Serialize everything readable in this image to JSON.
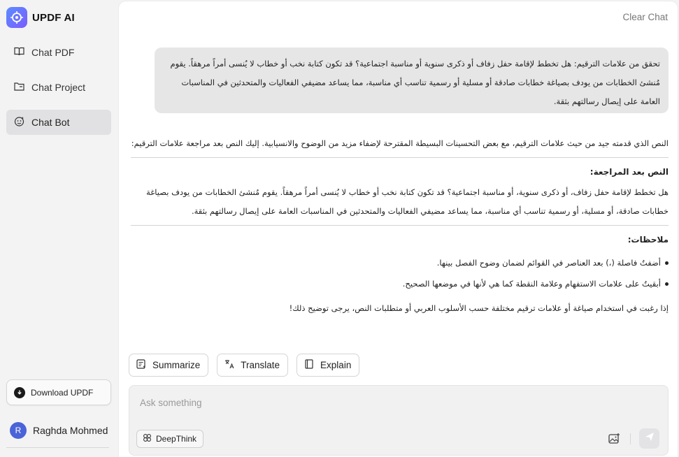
{
  "brand": {
    "name": "UPDF AI"
  },
  "sidebar": {
    "items": [
      {
        "label": "Chat PDF",
        "icon": "book-open-icon"
      },
      {
        "label": "Chat Project",
        "icon": "folder-icon"
      },
      {
        "label": "Chat Bot",
        "icon": "bot-face-icon",
        "active": true
      }
    ],
    "download_label": "Download UPDF",
    "user_initial": "R",
    "user_name": "Raghda Mohmed"
  },
  "header": {
    "clear_chat": "Clear Chat"
  },
  "conversation": {
    "user_message": "تحقق من علامات الترقيم: هل تخطط لإقامة حفل زفاف أو ذكرى سنوية أو مناسبة اجتماعية؟ قد تكون كتابة نخب أو خطاب لا يُنسى أمراً مرهقاً. يقوم مُنشئ الخطابات من يودف بصياغة خطابات صادقة أو مسلية أو رسمية تناسب أي مناسبة، مما يساعد مضيفي الفعاليات والمتحدثين في المناسبات العامة على إيصال رسالتهم بثقة.",
    "answer": {
      "intro": "النص الذي قدمته جيد من حيث علامات الترقيم، مع بعض التحسينات البسيطة المقترحة لإضفاء مزيد من الوضوح والانسيابية. إليك النص بعد مراجعة علامات الترقيم:",
      "revised_heading": "النص بعد المراجعة:",
      "revised_text": "هل تخطط لإقامة حفل زفاف، أو ذكرى سنوية، أو مناسبة اجتماعية؟ قد تكون كتابة نخب أو خطاب لا يُنسى أمراً مرهقاً. يقوم مُنشئ الخطابات من يودف بصياغة خطابات صادقة، أو مسلية، أو رسمية تناسب أي مناسبة، مما يساعد مضيفي الفعاليات والمتحدثين في المناسبات العامة على إيصال رسالتهم بثقة.",
      "notes_heading": "ملاحظات:",
      "notes": [
        "أضفتُ فاصلة (،) بعد العناصر في القوائم لضمان وضوح الفصل بينها.",
        "أبقيتُ على علامات الاستفهام وعلامة النقطة كما هي لأنها في موضعها الصحيح."
      ],
      "closing": "إذا رغبت في استخدام صياغة أو علامات ترقيم مختلفة حسب الأسلوب العربي أو متطلبات النص، يرجى توضيح ذلك!"
    }
  },
  "actions": [
    {
      "label": "Summarize",
      "icon": "summarize-icon"
    },
    {
      "label": "Translate",
      "icon": "translate-icon"
    },
    {
      "label": "Explain",
      "icon": "book-icon"
    }
  ],
  "input": {
    "placeholder": "Ask something",
    "deepthink_label": "DeepThink"
  }
}
